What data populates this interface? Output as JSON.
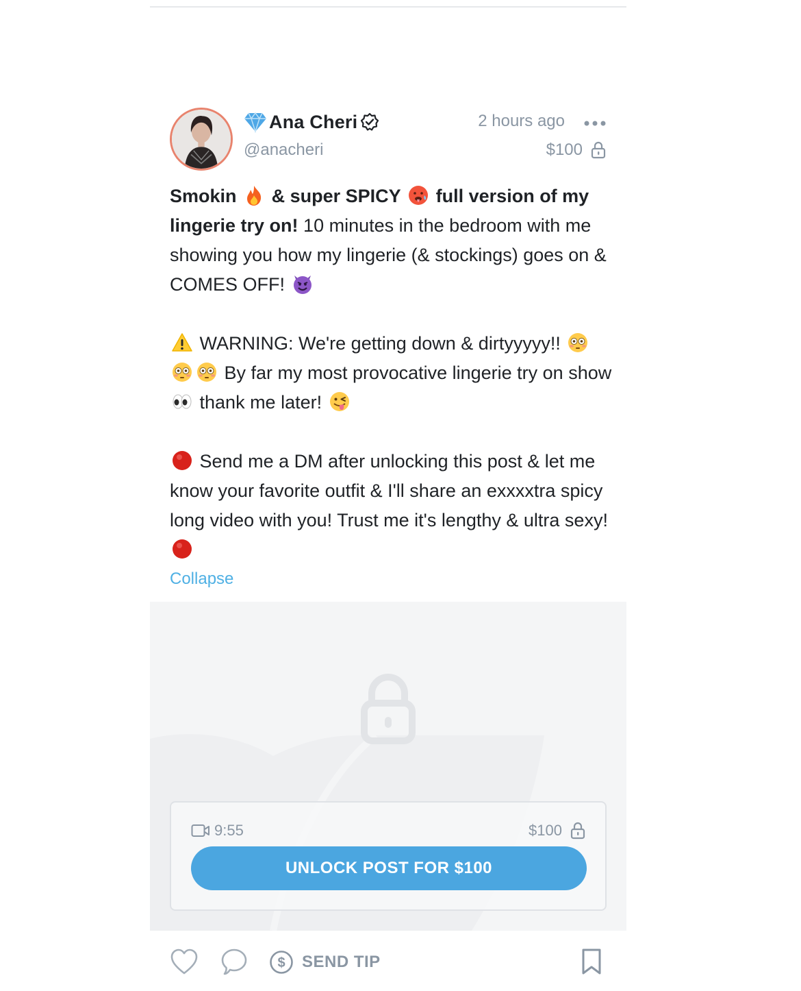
{
  "post": {
    "author": {
      "display_name": "Ana Cheri",
      "handle": "@anacheri",
      "badge_icon": "gem-icon",
      "verified_icon": "verified-icon"
    },
    "time_ago": "2 hours ago",
    "price": "$100",
    "text": {
      "p1_bold_a": "Smokin",
      "p1_bold_b": "& super SPICY",
      "p1_bold_c": "full version of my lingerie try on!",
      "p1_rest": "10 minutes in the bedroom with me showing you how my lingerie (& stockings) goes on & COMES OFF!",
      "p2_a": "WARNING: We're getting down & dirtyyyyy!!",
      "p2_b": "By far my most provocative lingerie try on show",
      "p2_c": "thank me later!",
      "p3_a": "Send me a DM after unlocking this post & let me know your favorite outfit & I'll share an exxxxtra spicy long video with you! Trust me it's lengthy & ultra sexy!"
    },
    "collapse_label": "Collapse",
    "media": {
      "duration": "9:55",
      "price": "$100",
      "unlock_button": "UNLOCK POST FOR $100"
    },
    "actions": {
      "send_tip": "SEND TIP"
    }
  },
  "colors": {
    "accent": "#4ba6e0",
    "link": "#4fb0e4",
    "muted_text": "#8a96a3",
    "avatar_ring": "#e8836d"
  }
}
